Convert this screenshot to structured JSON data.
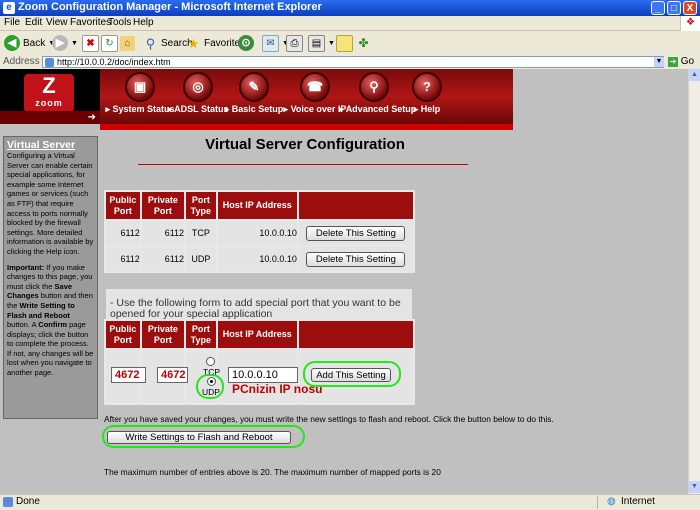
{
  "window": {
    "title": "Zoom Configuration Manager - Microsoft Internet Explorer",
    "controls": {
      "minimize": "_",
      "maximize": "□",
      "close": "X"
    }
  },
  "menu": [
    "File",
    "Edit",
    "View",
    "Favorites",
    "Tools",
    "Help"
  ],
  "toolbar": {
    "back": "Back",
    "search": "Search",
    "favorites": "Favorites"
  },
  "address": {
    "label": "Address",
    "url": "http://10.0.0.2/doc/index.htm",
    "go": "Go"
  },
  "header": {
    "logo": {
      "mark": "Z",
      "word": "zoom"
    },
    "nav": [
      {
        "label": "System Status",
        "glyph": "▣"
      },
      {
        "label": "ADSL Status",
        "glyph": "◎"
      },
      {
        "label": "Basic Setup",
        "glyph": "✎"
      },
      {
        "label": "Voice over IP",
        "glyph": "☎"
      },
      {
        "label": "Advanced Setup",
        "glyph": "⚲"
      },
      {
        "label": "Help",
        "glyph": "?"
      }
    ]
  },
  "help": {
    "title": "Virtual Server",
    "body": "Configuring a Virtual Server can enable certain special applications, for example some Internet games or services (such as FTP) that require access to ports normally blocked by the firewall settings. More detailed information is available by clicking the Help icon.",
    "important_label": "Important:",
    "important_1": " If you make changes to this page, you must click the ",
    "save_changes": "Save Changes",
    "important_2": " button and then the ",
    "write_setting": "Write Setting to Flash and Reboot",
    "important_3": " button. A ",
    "confirm": "Confirm",
    "important_4": " page displays; click the button to complete the process. If not, any changes will be lost when you navigate to another page."
  },
  "main": {
    "title": "Virtual Server Configuration",
    "columns": [
      "Public Port",
      "Private Port",
      "Port Type",
      "Host IP Address"
    ],
    "rows": [
      {
        "public": "6112",
        "private": "6112",
        "type": "TCP",
        "ip": "10.0.0.10",
        "action": "Delete This Setting"
      },
      {
        "public": "6112",
        "private": "6112",
        "type": "UDP",
        "ip": "10.0.0.10",
        "action": "Delete This Setting"
      }
    ],
    "instructions": "- Use the following form to add special port that you want to be opened for your special application",
    "form": {
      "public": "4672",
      "private": "4672",
      "tcp_label": "TCP",
      "udp_label": "UDP",
      "ip": "10.0.0.10",
      "add_button": "Add This Setting"
    },
    "annotation": "PCnizin IP nosu",
    "save_note": "After you have saved your changes, you must write the new settings to flash and reboot. Click the button below to do this.",
    "write_button": "Write Settings to Flash and Reboot",
    "limits": "The maximum number of entries above is  20. The maximum number of mapped ports is  20"
  },
  "status": {
    "left": "Done",
    "zone": "Internet"
  },
  "colors": {
    "header_red": "#9c0e0e",
    "highlight_green": "#22e81a",
    "annotation_red": "#c00000"
  }
}
